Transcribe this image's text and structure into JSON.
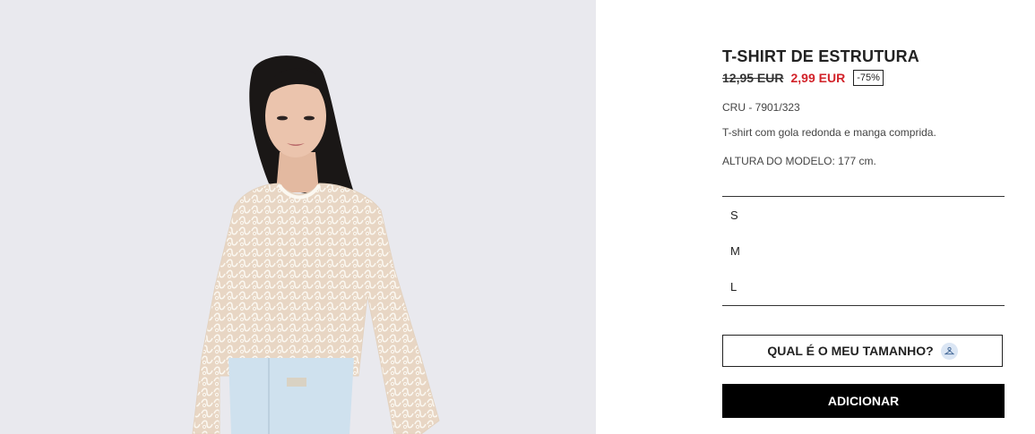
{
  "product": {
    "title": "T-SHIRT DE ESTRUTURA",
    "old_price": "12,95 EUR",
    "new_price": "2,99 EUR",
    "discount": "-75%",
    "color_ref": "CRU - 7901/323",
    "description": "T-shirt com gola redonda e manga comprida.",
    "model_height": "ALTURA DO MODELO: 177 cm.",
    "image_icon": "model-photo"
  },
  "sizes": [
    "S",
    "M",
    "L"
  ],
  "actions": {
    "size_guide_label": "QUAL É O MEU TAMANHO?",
    "size_guide_icon": "hanger-icon",
    "add_label": "ADICIONAR"
  },
  "colors": {
    "sale_red": "#d2232a",
    "button_black": "#000000",
    "photo_bg": "#e9e9ee"
  }
}
